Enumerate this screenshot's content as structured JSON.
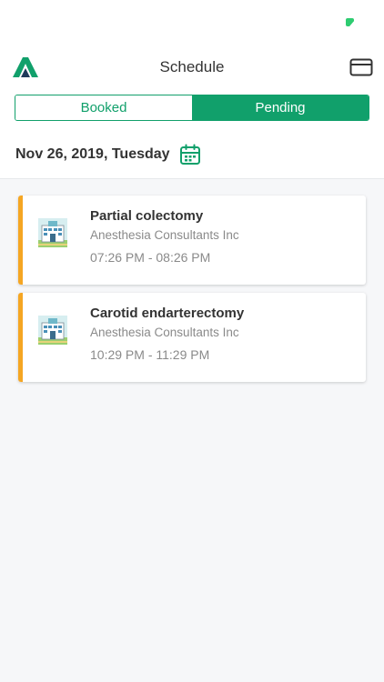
{
  "header": {
    "title": "Schedule",
    "logo_icon": "brand-logo-icon",
    "card_icon": "credit-card-icon"
  },
  "tabs": {
    "booked_label": "Booked",
    "pending_label": "Pending",
    "active": "pending"
  },
  "date": {
    "label": "Nov 26, 2019, Tuesday",
    "icon": "calendar-icon"
  },
  "colors": {
    "accent": "#11a06b",
    "status_bar_pending": "#f5a623",
    "battery": "#2ecc71"
  },
  "appointments": [
    {
      "title": "Partial colectomy",
      "organization": "Anesthesia Consultants Inc",
      "time": "07:26 PM - 08:26 PM",
      "icon": "hospital-building-icon"
    },
    {
      "title": "Carotid endarterectomy",
      "organization": "Anesthesia Consultants Inc",
      "time": "10:29 PM - 11:29 PM",
      "icon": "hospital-building-icon"
    }
  ]
}
